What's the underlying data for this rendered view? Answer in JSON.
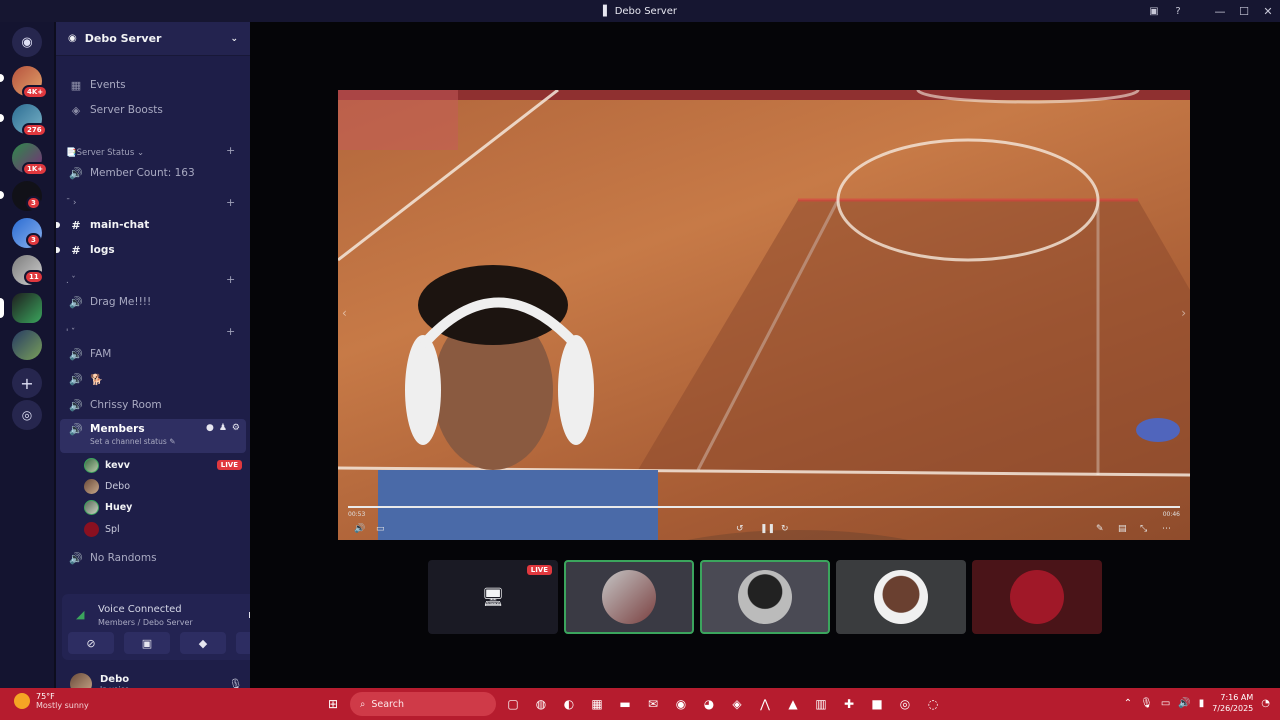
{
  "window": {
    "title": "Debo Server"
  },
  "rail": {
    "badges": [
      "4K+",
      "276",
      "1K+",
      "3",
      "3",
      "11"
    ]
  },
  "sidebar": {
    "server_name": "Debo Server",
    "top_items": [
      {
        "label": "Events",
        "icon": "calendar-icon"
      },
      {
        "label": "Server Boosts",
        "icon": "boost-icon"
      }
    ],
    "category_status": "📑Server Status",
    "member_count": "Member Count: 163",
    "category_2": "ˉ ›",
    "text_channels": [
      "main-chat",
      "logs"
    ],
    "category_3": ". ˇ",
    "drag_channel": "Drag Me!!!!",
    "category_4": "' ˇ",
    "voice_channels": [
      "FAM",
      "🐕",
      "Chrissy Room"
    ],
    "active_channel": "Members",
    "active_status": "Set a channel status",
    "members": [
      {
        "name": "kevv",
        "live": true
      },
      {
        "name": "Debo",
        "live": false
      },
      {
        "name": "Huey",
        "live": false
      },
      {
        "name": "Spl",
        "live": false
      }
    ],
    "live_label": "LIVE",
    "last_channel": "No Randoms"
  },
  "voice": {
    "title": "Voice Connected",
    "subtitle": "Members / Debo Server"
  },
  "user": {
    "name": "Debo",
    "status": "In voice"
  },
  "stream": {
    "time_current": "00:53",
    "time_total": "00:46",
    "progress": 1.0,
    "tile_live": "LIVE"
  },
  "taskbar": {
    "temp": "75°F",
    "condition": "Mostly sunny",
    "search": "Search",
    "time": "7:16 AM",
    "date": "7/26/2025"
  },
  "colors": {
    "live": "#e0383e",
    "speaking": "#3ba55d",
    "taskbar": "#b61c2e"
  }
}
